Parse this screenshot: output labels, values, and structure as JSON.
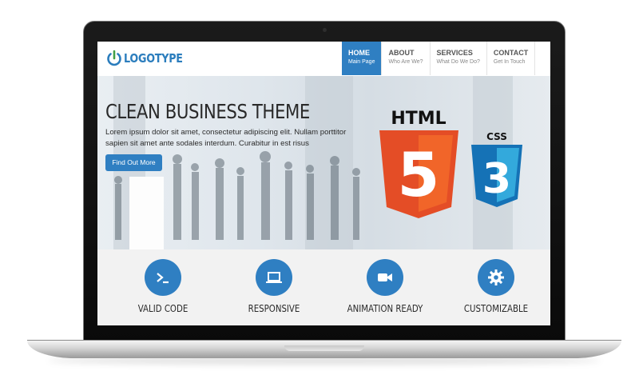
{
  "site": {
    "logo_text": "LOGOTYPE",
    "nav": [
      {
        "title": "HOME",
        "subtitle": "Main Page",
        "active": true
      },
      {
        "title": "ABOUT",
        "subtitle": "Who Are We?",
        "active": false
      },
      {
        "title": "SERVICES",
        "subtitle": "What Do We Do?",
        "active": false
      },
      {
        "title": "CONTACT",
        "subtitle": "Get In Touch",
        "active": false
      }
    ],
    "hero": {
      "title": "CLEAN BUSINESS THEME",
      "body": "Lorem ipsum dolor sit amet, consectetur adipiscing elit. Nullam porttitor sapien sit amet ante sodales interdum. Curabitur in est risus",
      "button_label": "Find Out More",
      "badges": {
        "html5_label": "HTML",
        "html5_digit": "5",
        "css3_label": "CSS",
        "css3_digit": "3"
      }
    },
    "features": [
      {
        "label": "VALID CODE",
        "icon": "terminal-icon"
      },
      {
        "label": "RESPONSIVE",
        "icon": "laptop-icon"
      },
      {
        "label": "ANIMATION READY",
        "icon": "video-camera-icon"
      },
      {
        "label": "CUSTOMIZABLE",
        "icon": "gear-icon"
      }
    ]
  },
  "colors": {
    "accent": "#2f7fc2",
    "html5_orange": "#e44d26",
    "css3_blue": "#1b73ba"
  }
}
